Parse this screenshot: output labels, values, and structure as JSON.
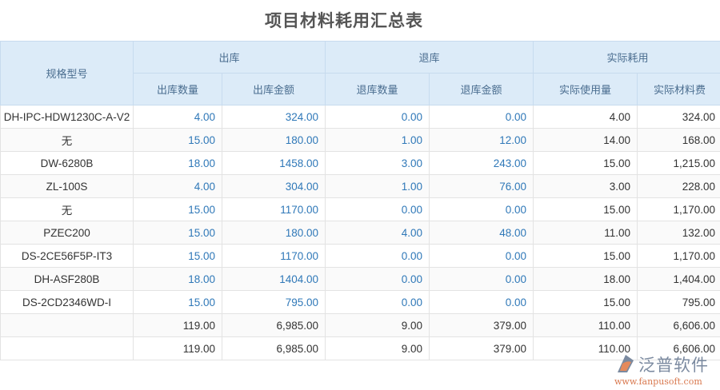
{
  "title": "项目材料耗用汇总表",
  "headers": {
    "spec": "规格型号",
    "out": "出库",
    "ret": "退库",
    "actual": "实际耗用",
    "out_qty": "出库数量",
    "out_amt": "出库金额",
    "ret_qty": "退库数量",
    "ret_amt": "退库金额",
    "act_qty": "实际使用量",
    "act_cost": "实际材料费"
  },
  "rows": [
    [
      "DH-IPC-HDW1230C-A-V2",
      "4.00",
      "324.00",
      "0.00",
      "0.00",
      "4.00",
      "324.00"
    ],
    [
      "无",
      "15.00",
      "180.00",
      "1.00",
      "12.00",
      "14.00",
      "168.00"
    ],
    [
      "DW-6280B",
      "18.00",
      "1458.00",
      "3.00",
      "243.00",
      "15.00",
      "1,215.00"
    ],
    [
      "ZL-100S",
      "4.00",
      "304.00",
      "1.00",
      "76.00",
      "3.00",
      "228.00"
    ],
    [
      "无",
      "15.00",
      "1170.00",
      "0.00",
      "0.00",
      "15.00",
      "1,170.00"
    ],
    [
      "PZEC200",
      "15.00",
      "180.00",
      "4.00",
      "48.00",
      "11.00",
      "132.00"
    ],
    [
      "DS-2CE56F5P-IT3",
      "15.00",
      "1170.00",
      "0.00",
      "0.00",
      "15.00",
      "1,170.00"
    ],
    [
      "DH-ASF280B",
      "18.00",
      "1404.00",
      "0.00",
      "0.00",
      "18.00",
      "1,404.00"
    ],
    [
      "DS-2CD2346WD-I",
      "15.00",
      "795.00",
      "0.00",
      "0.00",
      "15.00",
      "795.00"
    ],
    [
      "",
      "119.00",
      "6,985.00",
      "9.00",
      "379.00",
      "110.00",
      "6,606.00"
    ],
    [
      "",
      "119.00",
      "6,985.00",
      "9.00",
      "379.00",
      "110.00",
      "6,606.00"
    ]
  ],
  "logo": {
    "name": "泛普软件",
    "url": "www.fanpusoft.com"
  }
}
